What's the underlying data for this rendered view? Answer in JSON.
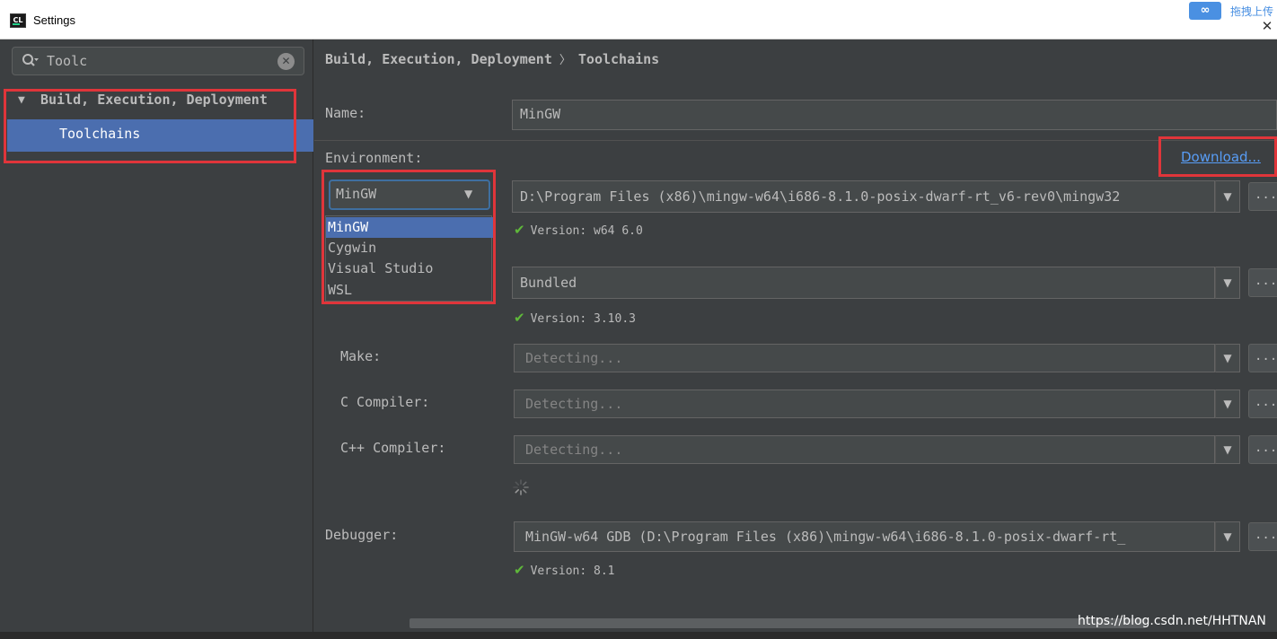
{
  "window": {
    "title": "Settings",
    "app_icon_text": "CL",
    "ext_badge": "∞",
    "ext_label": "拖拽上传",
    "close_glyph": "✕"
  },
  "sidebar": {
    "search_value": "Toolc",
    "search_clear_glyph": "✕",
    "tree_toggle_glyph": "▼",
    "tree_parent_label": "Build, Execution, Deployment",
    "tree_child_label": "Toolchains"
  },
  "breadcrumb": {
    "parent": "Build, Execution, Deployment",
    "separator": "〉",
    "current": "Toolchains"
  },
  "form": {
    "name_label": "Name:",
    "name_value": "MinGW",
    "environment_label": "Environment:",
    "download_link": "Download...",
    "environment_selected": "MinGW",
    "environment_options": [
      "MinGW",
      "Cygwin",
      "Visual Studio",
      "WSL"
    ],
    "environment_path": "D:\\Program Files (x86)\\mingw-w64\\i686-8.1.0-posix-dwarf-rt_v6-rev0\\mingw32",
    "environment_version": "Version: w64 6.0",
    "cmake_value": "Bundled",
    "cmake_version": "Version: 3.10.3",
    "make_label": "Make:",
    "make_value": "Detecting...",
    "c_compiler_label": "C Compiler:",
    "c_compiler_value": "Detecting...",
    "cpp_compiler_label": "C++ Compiler:",
    "cpp_compiler_value": "Detecting...",
    "debugger_label": "Debugger:",
    "debugger_value": "MinGW-w64 GDB (D:\\Program Files (x86)\\mingw-w64\\i686-8.1.0-posix-dwarf-rt_",
    "debugger_version": "Version: 8.1",
    "dropdown_arrow": "▼",
    "more_button_label": "...",
    "check_glyph": "✔"
  },
  "watermark": "https://blog.csdn.net/HHTNAN",
  "colors": {
    "background": "#3c3f41",
    "selection": "#4b6eaf",
    "highlight_box": "#e0353a",
    "link": "#589df6",
    "check": "#5fb83a"
  }
}
